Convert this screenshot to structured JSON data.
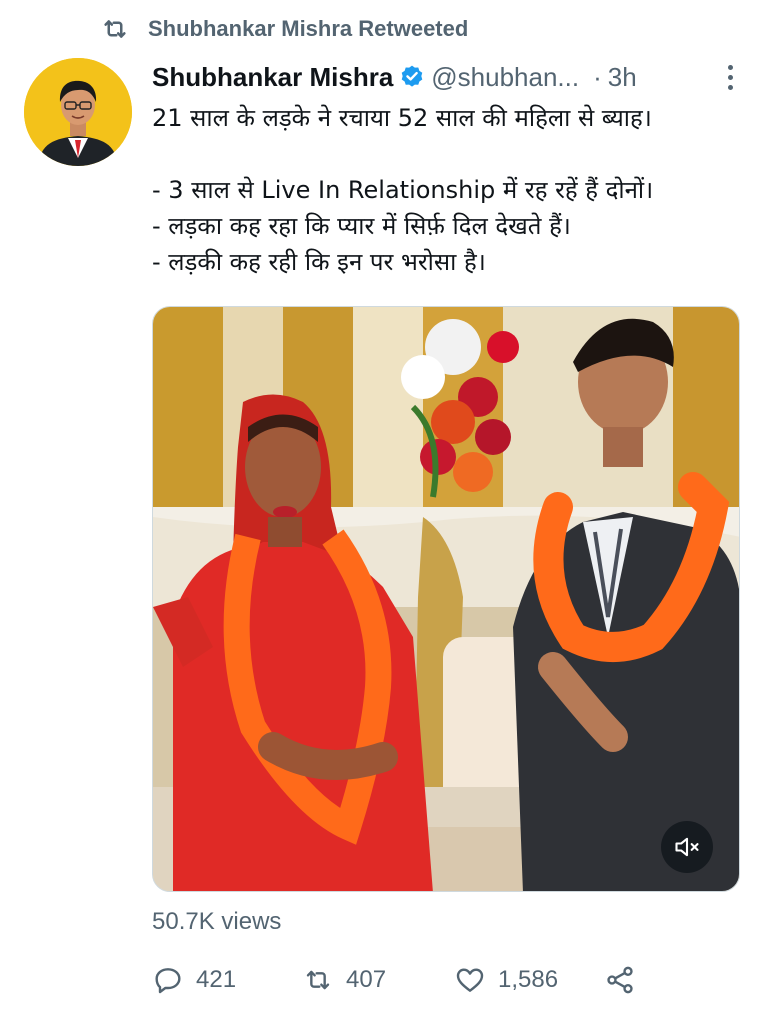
{
  "retweet_header": {
    "text": "Shubhankar Mishra Retweeted",
    "icon": "retweet-icon"
  },
  "author": {
    "name": "Shubhankar Mishra",
    "handle": "@shubhan...",
    "separator": "·",
    "time": "3h",
    "verified": true,
    "avatar_bg": "#f3c21a"
  },
  "tweet": {
    "line1": "21 साल के लड़के ने रचाया 52 साल की महिला से ब्याह।",
    "line2": "- 3 साल से Live In Relationship में रह रहें हैं दोनों।",
    "line3": "- लड़का कह रहा कि प्यार में सिर्फ़ दिल देखते हैं।",
    "line4": "- लड़की कह रही कि इन पर भरोसा है।"
  },
  "media": {
    "type": "video",
    "mute_icon": "muted-speaker-icon"
  },
  "views": "50.7K views",
  "actions": {
    "reply_count": "421",
    "retweet_count": "407",
    "like_count": "1,586"
  },
  "colors": {
    "text": "#0f1419",
    "secondary": "#536471",
    "verified": "#1d9bf0",
    "marigold": "#ff6a1a",
    "saree": "#e8322c"
  }
}
